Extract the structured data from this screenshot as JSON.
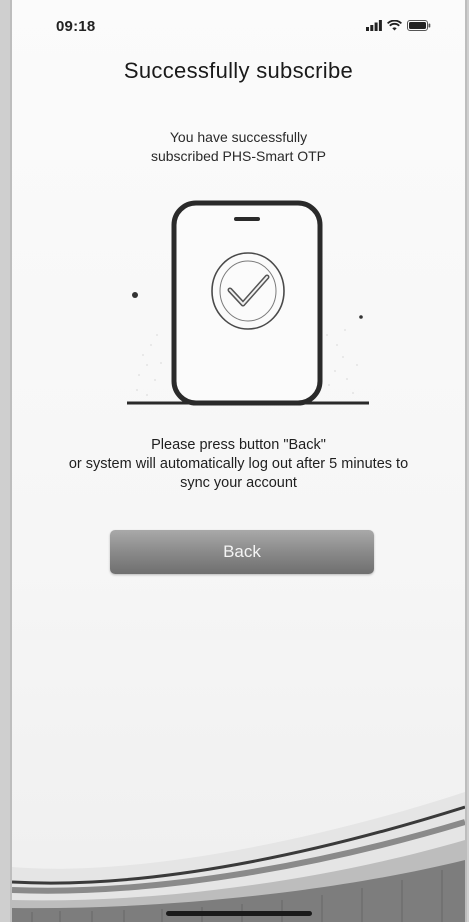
{
  "status_bar": {
    "time": "09:18",
    "icons": [
      "signal-icon",
      "wifi-icon",
      "battery-icon"
    ]
  },
  "screen": {
    "title": "Successfully subscribe",
    "subtitle_line1": "You have successfully",
    "subtitle_line2": "subscribed PHS-Smart OTP",
    "illustration_icon": "phone-check-icon",
    "instruction_line1": "Please press button \"Back\"",
    "instruction_line2": "or system will automatically log out after 5 minutes to",
    "instruction_line3": "sync your account",
    "back_label": "Back"
  },
  "colors": {
    "button": "#8a8a8a",
    "text": "#1f1f1f",
    "background": "#f7f7f7"
  }
}
